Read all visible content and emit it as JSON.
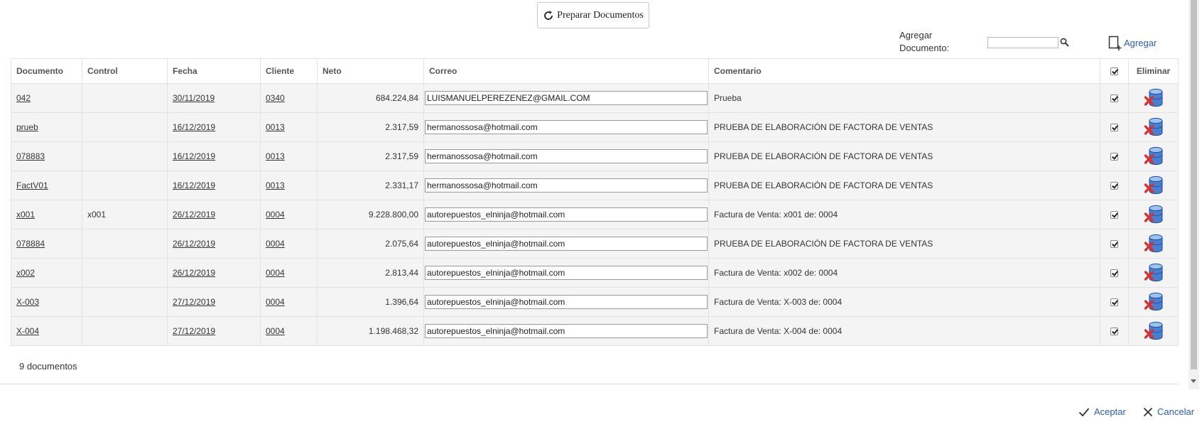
{
  "toolbar": {
    "prepare_label": "Preparar Documentos"
  },
  "add_doc": {
    "label": "Agregar Documento:",
    "value": "",
    "add_label": "Agregar"
  },
  "table": {
    "headers": [
      "Documento",
      "Control",
      "Fecha",
      "Cliente",
      "Neto",
      "Correo",
      "Comentario",
      "",
      "Eliminar"
    ],
    "rows": [
      {
        "documento": "042",
        "control": "",
        "fecha": "30/11/2019",
        "cliente": "0340",
        "neto": "684.224,84",
        "correo": "LUISMANUELPEREZENEZ@GMAIL.COM",
        "comentario": "Prueba",
        "checked": true
      },
      {
        "documento": "prueb",
        "control": "",
        "fecha": "16/12/2019",
        "cliente": "0013",
        "neto": "2.317,59",
        "correo": "hermanossosa@hotmail.com",
        "comentario": "PRUEBA DE ELABORACIÓN DE FACTORA DE VENTAS",
        "checked": true
      },
      {
        "documento": "078883",
        "control": "",
        "fecha": "16/12/2019",
        "cliente": "0013",
        "neto": "2.317,59",
        "correo": "hermanossosa@hotmail.com",
        "comentario": "PRUEBA DE ELABORACIÓN DE FACTORA DE VENTAS",
        "checked": true
      },
      {
        "documento": "FactV01",
        "control": "",
        "fecha": "16/12/2019",
        "cliente": "0013",
        "neto": "2.331,17",
        "correo": "hermanossosa@hotmail.com",
        "comentario": "PRUEBA DE ELABORACIÓN DE FACTORA DE VENTAS",
        "checked": true
      },
      {
        "documento": "x001",
        "control": "x001",
        "fecha": "26/12/2019",
        "cliente": "0004",
        "neto": "9.228.800,00",
        "correo": "autorepuestos_elninja@hotmail.com",
        "comentario": "Factura de Venta: x001 de: 0004",
        "checked": true
      },
      {
        "documento": "078884",
        "control": "",
        "fecha": "26/12/2019",
        "cliente": "0004",
        "neto": "2.075,64",
        "correo": "autorepuestos_elninja@hotmail.com",
        "comentario": "PRUEBA DE ELABORACIÓN DE FACTORA DE VENTAS",
        "checked": true
      },
      {
        "documento": "x002",
        "control": "",
        "fecha": "26/12/2019",
        "cliente": "0004",
        "neto": "2.813,44",
        "correo": "autorepuestos_elninja@hotmail.com",
        "comentario": "Factura de Venta: x002 de: 0004",
        "checked": true
      },
      {
        "documento": "X-003",
        "control": "",
        "fecha": "27/12/2019",
        "cliente": "0004",
        "neto": "1.396,64",
        "correo": "autorepuestos_elninja@hotmail.com",
        "comentario": "Factura de Venta: X-003 de: 0004",
        "checked": true
      },
      {
        "documento": "X-004",
        "control": "",
        "fecha": "27/12/2019",
        "cliente": "0004",
        "neto": "1.198.468,32",
        "correo": "autorepuestos_elninja@hotmail.com",
        "comentario": "Factura de Venta: X-004 de: 0004",
        "checked": true
      }
    ]
  },
  "footer": {
    "count_label": "9 documentos"
  },
  "dialog": {
    "accept_label": "Aceptar",
    "cancel_label": "Cancelar"
  },
  "icons": {
    "refresh": "refresh-icon",
    "search": "search-icon",
    "add": "add-document-icon",
    "delete": "delete-database-icon",
    "accept": "checkmark-icon",
    "cancel": "close-icon"
  },
  "colors": {
    "link_blue": "#2a5db0",
    "row_bg": "#f4f4f4",
    "delete_red": "#d93030",
    "db_blue": "#4a7fd0"
  }
}
